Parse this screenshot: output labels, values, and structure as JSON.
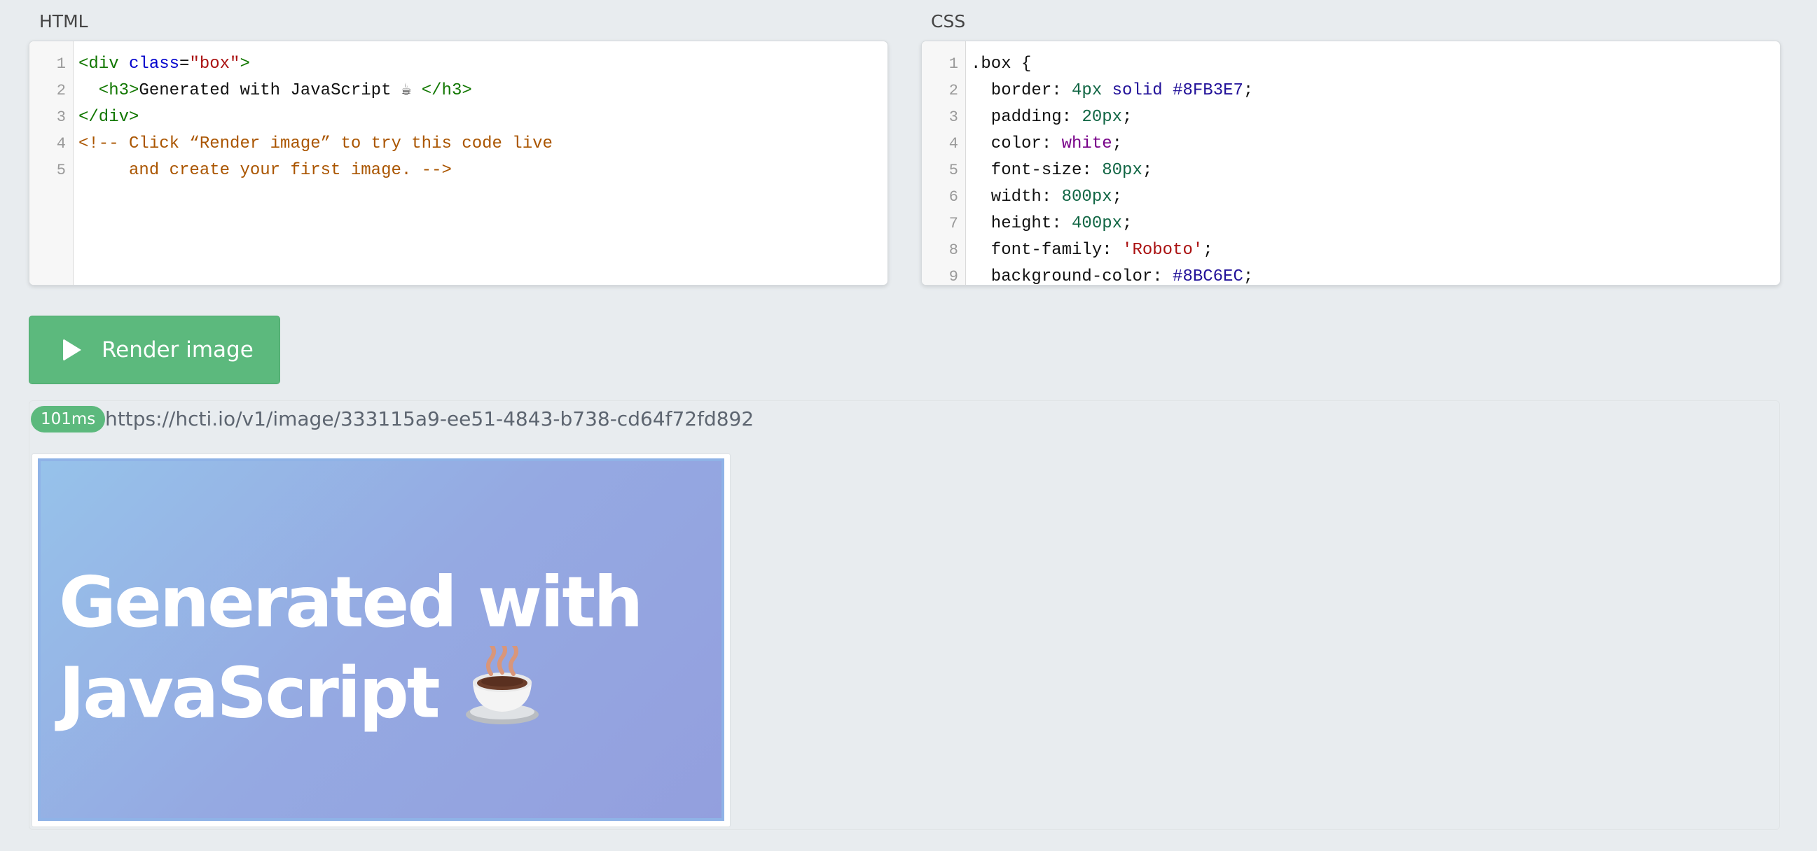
{
  "html_panel": {
    "title": "HTML",
    "lines": [
      {
        "num": "1",
        "segments": [
          {
            "t": "<div ",
            "c": "tag"
          },
          {
            "t": "class",
            "c": "attr"
          },
          {
            "t": "=",
            "c": ""
          },
          {
            "t": "\"box\"",
            "c": "str"
          },
          {
            "t": ">",
            "c": "tag"
          }
        ]
      },
      {
        "num": "2",
        "segments": [
          {
            "t": "  <h3>",
            "c": "tag"
          },
          {
            "t": "Generated with JavaScript ☕ ",
            "c": ""
          },
          {
            "t": "</h3>",
            "c": "tag"
          }
        ]
      },
      {
        "num": "3",
        "segments": [
          {
            "t": "</div>",
            "c": "tag"
          }
        ]
      },
      {
        "num": "4",
        "segments": [
          {
            "t": "<!-- Click “Render image” to try this code live",
            "c": "comment"
          }
        ]
      },
      {
        "num": "5",
        "segments": [
          {
            "t": "     and create your first image. -->",
            "c": "comment"
          }
        ]
      }
    ]
  },
  "css_panel": {
    "title": "CSS",
    "lines": [
      {
        "num": "1",
        "segments": [
          {
            "t": ".box {",
            "c": ""
          }
        ]
      },
      {
        "num": "2",
        "segments": [
          {
            "t": "  border: ",
            "c": ""
          },
          {
            "t": "4px",
            "c": "num"
          },
          {
            "t": " ",
            "c": ""
          },
          {
            "t": "solid",
            "c": "kw"
          },
          {
            "t": " ",
            "c": ""
          },
          {
            "t": "#8FB3E7",
            "c": "color"
          },
          {
            "t": ";",
            "c": ""
          }
        ]
      },
      {
        "num": "3",
        "segments": [
          {
            "t": "  padding: ",
            "c": ""
          },
          {
            "t": "20px",
            "c": "num"
          },
          {
            "t": ";",
            "c": ""
          }
        ]
      },
      {
        "num": "4",
        "segments": [
          {
            "t": "  color: ",
            "c": ""
          },
          {
            "t": "white",
            "c": "atom"
          },
          {
            "t": ";",
            "c": ""
          }
        ]
      },
      {
        "num": "5",
        "segments": [
          {
            "t": "  font-size: ",
            "c": ""
          },
          {
            "t": "80px",
            "c": "num"
          },
          {
            "t": ";",
            "c": ""
          }
        ]
      },
      {
        "num": "6",
        "segments": [
          {
            "t": "  width: ",
            "c": ""
          },
          {
            "t": "800px",
            "c": "num"
          },
          {
            "t": ";",
            "c": ""
          }
        ]
      },
      {
        "num": "7",
        "segments": [
          {
            "t": "  height: ",
            "c": ""
          },
          {
            "t": "400px",
            "c": "num"
          },
          {
            "t": ";",
            "c": ""
          }
        ]
      },
      {
        "num": "8",
        "segments": [
          {
            "t": "  font-family: ",
            "c": ""
          },
          {
            "t": "'Roboto'",
            "c": "str"
          },
          {
            "t": ";",
            "c": ""
          }
        ]
      },
      {
        "num": "9",
        "segments": [
          {
            "t": "  background-color: ",
            "c": ""
          },
          {
            "t": "#8BC6EC",
            "c": "color"
          },
          {
            "t": ";",
            "c": ""
          }
        ]
      }
    ]
  },
  "render_button": {
    "label": "Render image",
    "icon": "play-icon",
    "color": "#5cb97d"
  },
  "result": {
    "timing": "101ms",
    "url": "https://hcti.io/v1/image/333115a9-ee51-4843-b738-cd64f72fd892",
    "preview_heading": "Generated with JavaScript",
    "preview_emoji": "coffee-cup-icon",
    "preview_border_color": "#8FB3E7"
  }
}
